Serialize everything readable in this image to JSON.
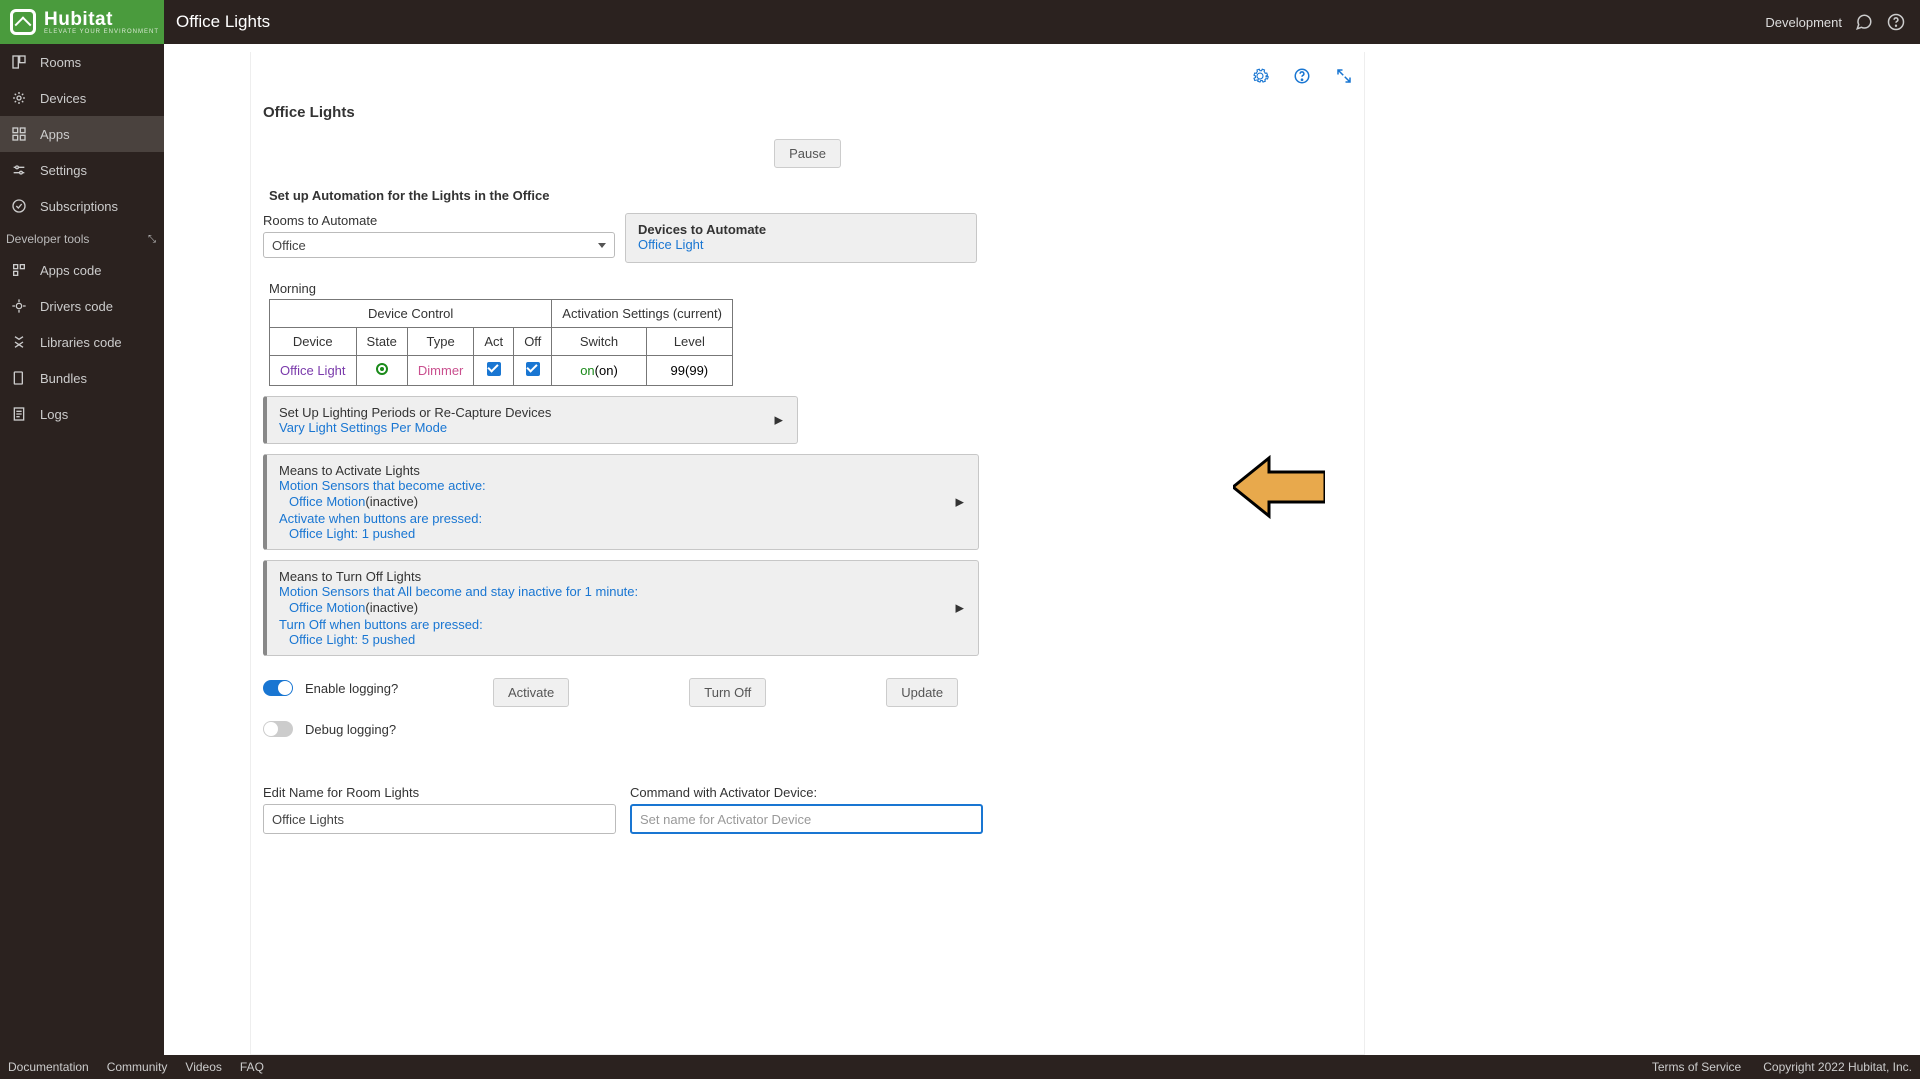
{
  "brand": {
    "name": "Hubitat",
    "tagline": "ELEVATE YOUR ENVIRONMENT"
  },
  "top": {
    "pageTitle": "Office Lights",
    "rightLabel": "Development"
  },
  "sidebar": {
    "items": [
      {
        "label": "Rooms",
        "icon": "rooms"
      },
      {
        "label": "Devices",
        "icon": "devices"
      },
      {
        "label": "Apps",
        "icon": "apps",
        "active": true
      },
      {
        "label": "Settings",
        "icon": "settings"
      },
      {
        "label": "Subscriptions",
        "icon": "subs"
      }
    ],
    "devSection": "Developer tools",
    "devItems": [
      {
        "label": "Apps code"
      },
      {
        "label": "Drivers code"
      },
      {
        "label": "Libraries code"
      },
      {
        "label": "Bundles"
      },
      {
        "label": "Logs"
      }
    ]
  },
  "main": {
    "title": "Office Lights",
    "pause": "Pause",
    "setupHeading": "Set up Automation for the Lights in the Office",
    "roomsLabel": "Rooms to Automate",
    "roomsValue": "Office",
    "devicesLabel": "Devices to Automate",
    "devicesLink": "Office Light",
    "periodLabel": "Morning",
    "table": {
      "head1": "Device Control",
      "head2": "Activation Settings (current)",
      "cols": [
        "Device",
        "State",
        "Type",
        "Act",
        "Off",
        "Switch",
        "Level"
      ],
      "row": {
        "device": "Office Light",
        "type": "Dimmer",
        "switchOn": "on",
        "switchCur": "(on)",
        "level": "99",
        "levelCur": "(99)"
      }
    },
    "periodsCard": {
      "title": "Set Up Lighting Periods or Re-Capture Devices",
      "link": "Vary Light Settings Per Mode"
    },
    "activateCard": {
      "title": "Means to Activate Lights",
      "l1": "Motion Sensors that become active:",
      "l2a": "Office Motion",
      "l2b": "(inactive)",
      "l3": "Activate when buttons are pressed:",
      "l4": "Office Light: 1 pushed"
    },
    "offCard": {
      "title": "Means to Turn Off Lights",
      "l1": "Motion Sensors that All become and stay inactive for 1 minute:",
      "l2a": "Office Motion",
      "l2b": "(inactive)",
      "l3": "Turn Off when buttons are pressed:",
      "l4": "Office Light: 5 pushed"
    },
    "enableLogging": "Enable logging?",
    "debugLogging": "Debug logging?",
    "btnActivate": "Activate",
    "btnTurnOff": "Turn Off",
    "btnUpdate": "Update",
    "editNameLabel": "Edit Name for Room Lights",
    "editNameValue": "Office Lights",
    "activatorLabel": "Command with Activator Device:",
    "activatorPlaceholder": "Set name for Activator Device"
  },
  "footer": {
    "left": [
      "Documentation",
      "Community",
      "Videos",
      "FAQ"
    ],
    "right": [
      "Terms of Service",
      "Copyright 2022 Hubitat, Inc."
    ]
  }
}
